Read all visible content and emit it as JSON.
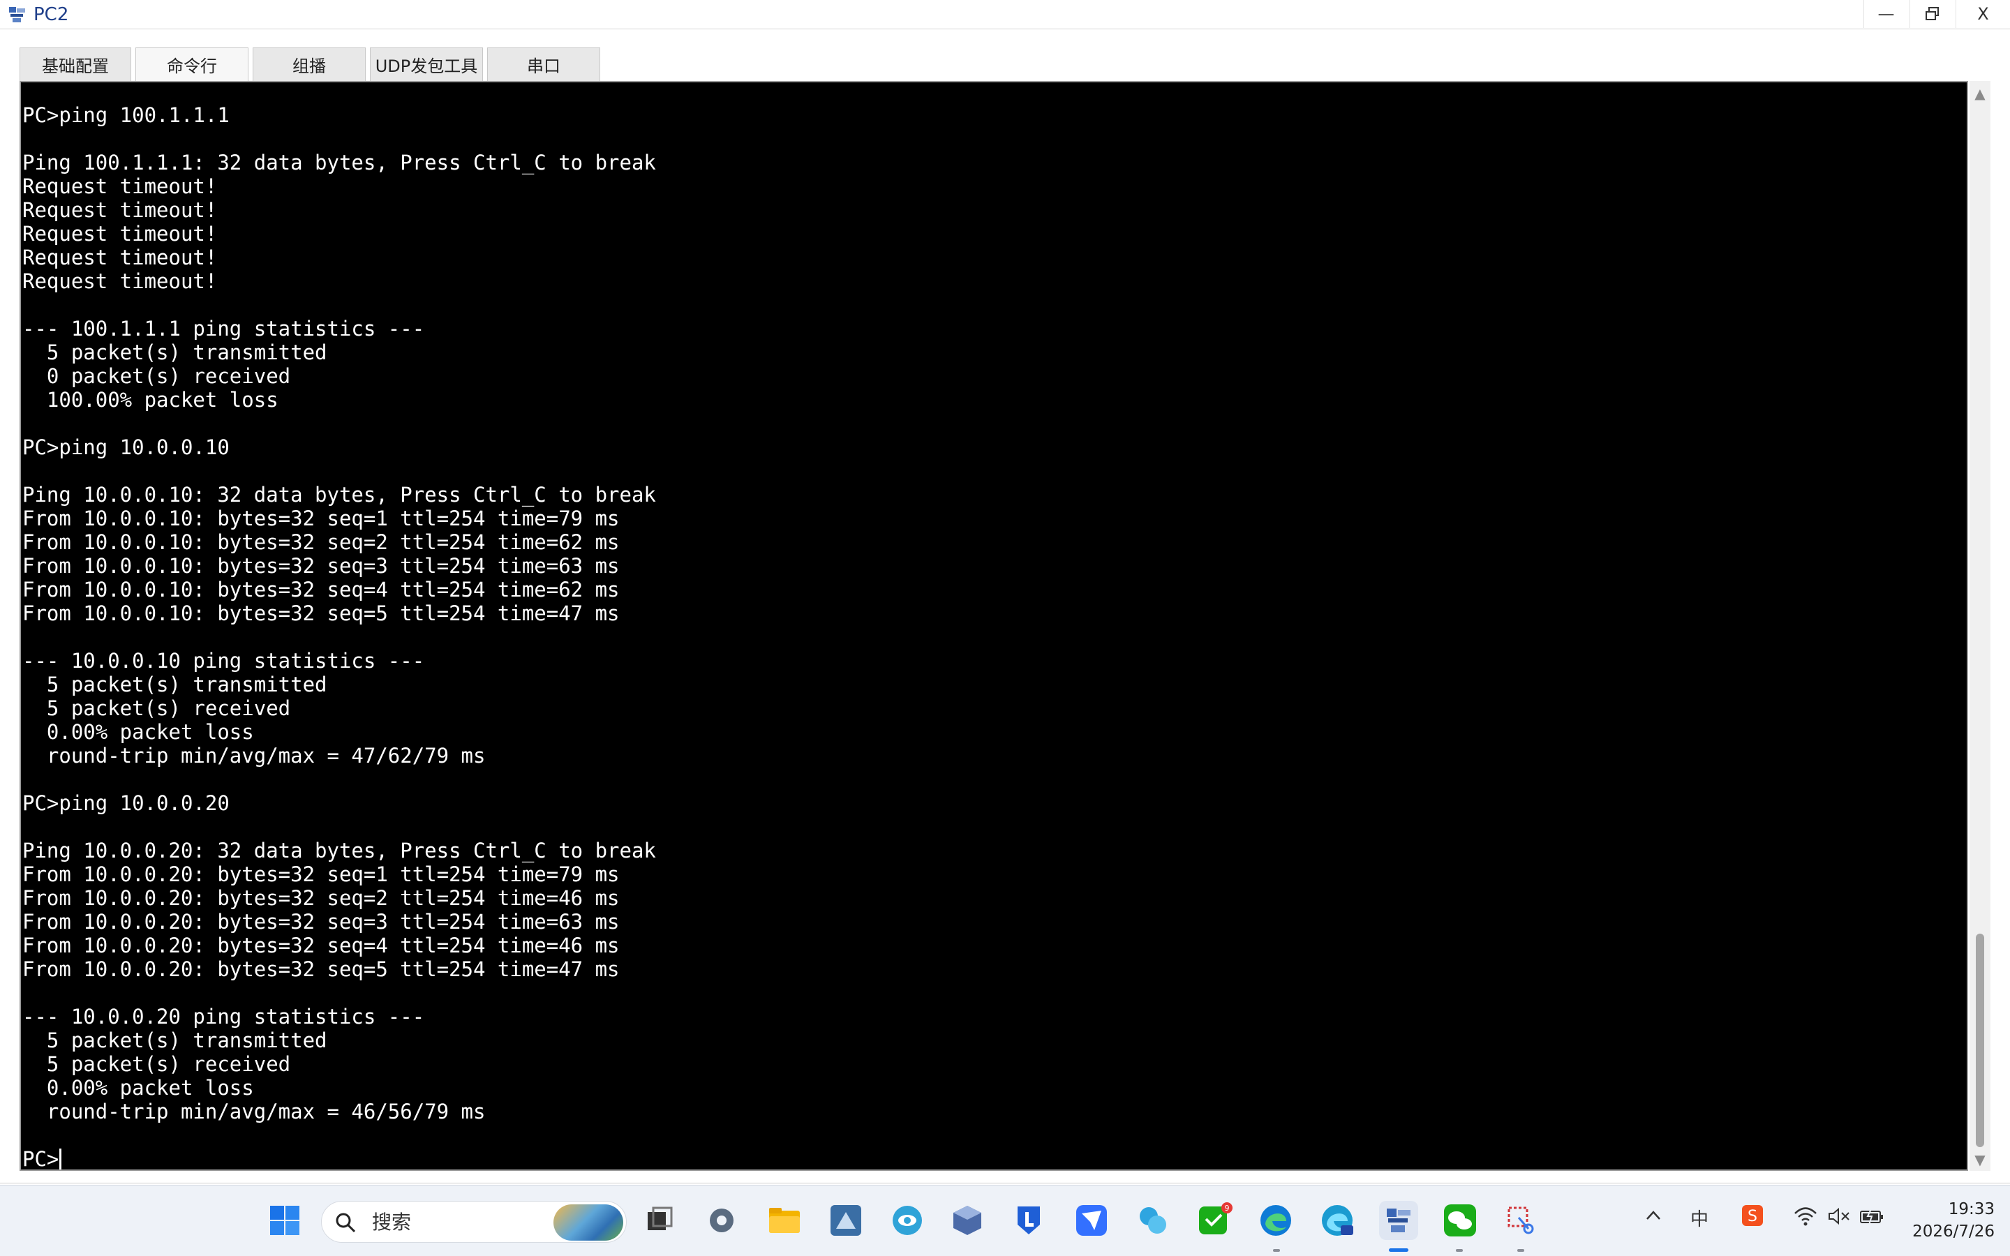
{
  "window": {
    "title": "PC2",
    "min_glyph": "—",
    "max_glyph": "🗗",
    "close_glyph": "X"
  },
  "tabs": [
    {
      "label": "基础配置",
      "active": false
    },
    {
      "label": "命令行",
      "active": true
    },
    {
      "label": "组播",
      "active": false
    },
    {
      "label": "UDP发包工具",
      "active": false
    },
    {
      "label": "串口",
      "active": false
    }
  ],
  "terminal": {
    "lines": [
      "PC>ping 100.1.1.1",
      "",
      "Ping 100.1.1.1: 32 data bytes, Press Ctrl_C to break",
      "Request timeout!",
      "Request timeout!",
      "Request timeout!",
      "Request timeout!",
      "Request timeout!",
      "",
      "--- 100.1.1.1 ping statistics ---",
      "  5 packet(s) transmitted",
      "  0 packet(s) received",
      "  100.00% packet loss",
      "",
      "PC>ping 10.0.0.10",
      "",
      "Ping 10.0.0.10: 32 data bytes, Press Ctrl_C to break",
      "From 10.0.0.10: bytes=32 seq=1 ttl=254 time=79 ms",
      "From 10.0.0.10: bytes=32 seq=2 ttl=254 time=62 ms",
      "From 10.0.0.10: bytes=32 seq=3 ttl=254 time=63 ms",
      "From 10.0.0.10: bytes=32 seq=4 ttl=254 time=62 ms",
      "From 10.0.0.10: bytes=32 seq=5 ttl=254 time=47 ms",
      "",
      "--- 10.0.0.10 ping statistics ---",
      "  5 packet(s) transmitted",
      "  5 packet(s) received",
      "  0.00% packet loss",
      "  round-trip min/avg/max = 47/62/79 ms",
      "",
      "PC>ping 10.0.0.20",
      "",
      "Ping 10.0.0.20: 32 data bytes, Press Ctrl_C to break",
      "From 10.0.0.20: bytes=32 seq=1 ttl=254 time=79 ms",
      "From 10.0.0.20: bytes=32 seq=2 ttl=254 time=46 ms",
      "From 10.0.0.20: bytes=32 seq=3 ttl=254 time=63 ms",
      "From 10.0.0.20: bytes=32 seq=4 ttl=254 time=46 ms",
      "From 10.0.0.20: bytes=32 seq=5 ttl=254 time=47 ms",
      "",
      "--- 10.0.0.20 ping statistics ---",
      "  5 packet(s) transmitted",
      "  5 packet(s) received",
      "  0.00% packet loss",
      "  round-trip min/avg/max = 46/56/79 ms",
      "",
      "PC>"
    ],
    "text_color": "#ffffff",
    "background": "#000000"
  },
  "taskbar": {
    "search_placeholder": "搜索",
    "pinned_apps": [
      {
        "name": "start-icon",
        "color": "#1a73e8"
      },
      {
        "name": "task-view-icon",
        "color": "#333333"
      },
      {
        "name": "settings-icon",
        "color": "#5a6b80"
      },
      {
        "name": "file-explorer-icon",
        "color": "#f4b400"
      },
      {
        "name": "dbeaver-icon",
        "color": "#3a6ea5"
      },
      {
        "name": "eye-care-icon",
        "color": "#2fa3d8"
      },
      {
        "name": "virtualbox-icon",
        "color": "#4b6aa8"
      },
      {
        "name": "lenovo-l-icon",
        "color": "#1f5fd6"
      },
      {
        "name": "feishu-icon",
        "color": "#3370ff"
      },
      {
        "name": "camera-app-icon",
        "color": "#2ea5e0"
      },
      {
        "name": "green-app-icon",
        "color": "#1aad19"
      },
      {
        "name": "edge-icon",
        "color": "#0f7bd6"
      },
      {
        "name": "edge-ai-icon",
        "color": "#1b9bd1"
      },
      {
        "name": "ensp-icon",
        "color": "#2a5db0"
      },
      {
        "name": "wechat-icon",
        "color": "#1aad19"
      },
      {
        "name": "snipping-tool-icon",
        "color": "#d13438"
      }
    ],
    "badge_count": "9",
    "ime_label": "中",
    "clock_time": "19:33",
    "clock_date": "2026/7/26"
  }
}
